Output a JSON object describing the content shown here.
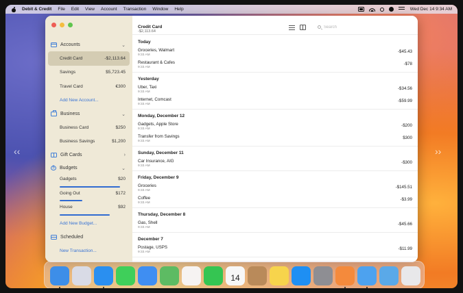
{
  "menubar": {
    "app_name": "Debit & Credit",
    "menus": [
      "File",
      "Edit",
      "View",
      "Account",
      "Transaction",
      "Window",
      "Help"
    ],
    "clock": "Wed Dec 14  9:34 AM"
  },
  "sidebar": {
    "sections": [
      {
        "label": "Accounts",
        "icon": "wallet-icon"
      },
      {
        "label": "Business",
        "icon": "briefcase-icon"
      },
      {
        "label": "Gift Cards",
        "icon": "gift-icon"
      },
      {
        "label": "Budgets",
        "icon": "dollar-circle-icon"
      },
      {
        "label": "Scheduled",
        "icon": "calendar-icon"
      }
    ],
    "accounts": [
      {
        "label": "Credit Card",
        "amount": "-$2,113.64"
      },
      {
        "label": "Savings",
        "amount": "$5,723.45"
      },
      {
        "label": "Travel Card",
        "amount": "€300"
      }
    ],
    "add_account": "Add New Account...",
    "business": [
      {
        "label": "Business Card",
        "amount": "$250"
      },
      {
        "label": "Business Savings",
        "amount": "$1,200"
      }
    ],
    "budgets": [
      {
        "label": "Gadgets",
        "amount": "$20",
        "progress": 0.92
      },
      {
        "label": "Going Out",
        "amount": "$172",
        "progress": 0.34
      },
      {
        "label": "House",
        "amount": "$92",
        "progress": 0.76
      }
    ],
    "add_budget": "Add New Budget...",
    "add_transaction": "New Transaction..."
  },
  "toolbar": {
    "title": "Credit Card",
    "balance": "-$2,113.64",
    "search_placeholder": "Search"
  },
  "transactions": [
    {
      "heading": "Today",
      "items": [
        {
          "name": "Groceries, Walmart",
          "time": "9:33 AM",
          "amount": "-$45.43"
        },
        {
          "name": "Restaurant & Cafes",
          "time": "9:33 AM",
          "amount": "-$78"
        }
      ]
    },
    {
      "heading": "Yesterday",
      "items": [
        {
          "name": "Uber, Taxi",
          "time": "9:33 AM",
          "amount": "-$34.56"
        },
        {
          "name": "Internet, Comcast",
          "time": "9:33 AM",
          "amount": "-$59.99"
        }
      ]
    },
    {
      "heading": "Monday, December 12",
      "items": [
        {
          "name": "Gadgets, Apple Store",
          "time": "9:33 AM",
          "amount": "-$200"
        },
        {
          "name": "Transfer from Savings",
          "time": "9:33 AM",
          "amount": "$300"
        }
      ]
    },
    {
      "heading": "Sunday, December 11",
      "items": [
        {
          "name": "Car Insurance, AIG",
          "time": "9:33 AM",
          "amount": "-$300"
        }
      ]
    },
    {
      "heading": "Friday, December 9",
      "items": [
        {
          "name": "Groceries",
          "time": "9:33 AM",
          "amount": "-$145.51"
        },
        {
          "name": "Coffee",
          "time": "9:33 AM",
          "amount": "-$3.99"
        }
      ]
    },
    {
      "heading": "Thursday, December 8",
      "items": [
        {
          "name": "Gas, Shell",
          "time": "9:33 AM",
          "amount": "-$45.66"
        }
      ]
    },
    {
      "heading": "December 7",
      "items": [
        {
          "name": "Postage, USPS",
          "time": "9:33 AM",
          "amount": "-$11.99"
        }
      ]
    }
  ],
  "dock": {
    "calendar_day": "14",
    "apps": [
      {
        "name": "finder-icon",
        "color": "#3d8ee8"
      },
      {
        "name": "launchpad-icon",
        "color": "#d9dbe6"
      },
      {
        "name": "safari-icon",
        "color": "#2a8ff0"
      },
      {
        "name": "messages-icon",
        "color": "#3fcf5a"
      },
      {
        "name": "mail-icon",
        "color": "#3f8ef2"
      },
      {
        "name": "maps-icon",
        "color": "#5dbb63"
      },
      {
        "name": "photos-icon",
        "color": "#f6f3f2"
      },
      {
        "name": "facetime-icon",
        "color": "#35c552"
      },
      {
        "name": "calendar-icon",
        "color": "#f7f7f7"
      },
      {
        "name": "contacts-icon",
        "color": "#b98a5a"
      },
      {
        "name": "notes-icon",
        "color": "#f7d44c"
      },
      {
        "name": "app-store-icon",
        "color": "#1e8ff3"
      },
      {
        "name": "system-settings-icon",
        "color": "#8e8e93"
      },
      {
        "name": "debit-credit-icon",
        "color": "#f48a3c"
      },
      {
        "name": "screen-sharing-icon",
        "color": "#4da2ef"
      },
      {
        "name": "downloads-folder-icon",
        "color": "#5aa9e8"
      },
      {
        "name": "trash-icon",
        "color": "#e8e8ea"
      }
    ]
  }
}
